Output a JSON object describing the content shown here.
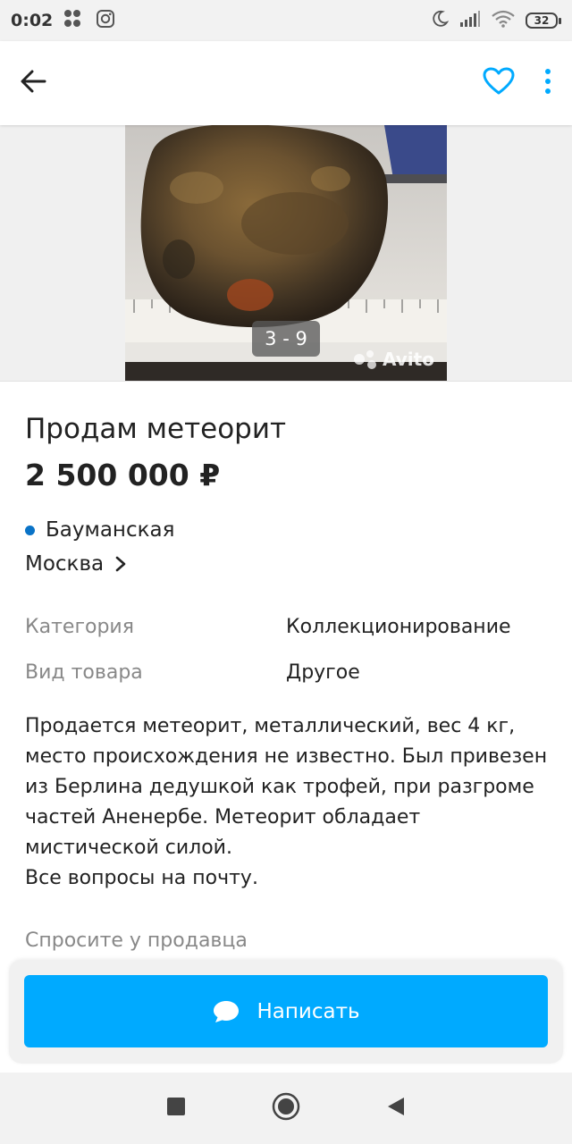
{
  "status_bar": {
    "time": "0:02",
    "battery": "32"
  },
  "colors": {
    "accent": "#00aaff",
    "metro_dot": "#0a73c7"
  },
  "gallery": {
    "counter": "3 - 9",
    "watermark": "Avito"
  },
  "listing": {
    "title": "Продам метеорит",
    "price": "2 500 000 ₽",
    "metro": "Бауманская",
    "city": "Москва"
  },
  "params": [
    {
      "label": "Категория",
      "value": "Коллекционирование"
    },
    {
      "label": "Вид товара",
      "value": "Другое"
    }
  ],
  "description": {
    "text": "Продается метеорит, металлический, вес 4 кг, место происхождения не известно. Был привезен из Берлина дедушкой как трофей, при разгроме частей Аненербе. Метеорит обладает мистической силой.",
    "footer": "Все вопросы на почту."
  },
  "ask_seller": "Спросите у продавца",
  "actions": {
    "write": "Написать"
  },
  "icons": {
    "back": "back-arrow-icon",
    "favorite": "heart-icon",
    "more": "more-vertical-icon",
    "chat": "chat-bubble-icon"
  }
}
